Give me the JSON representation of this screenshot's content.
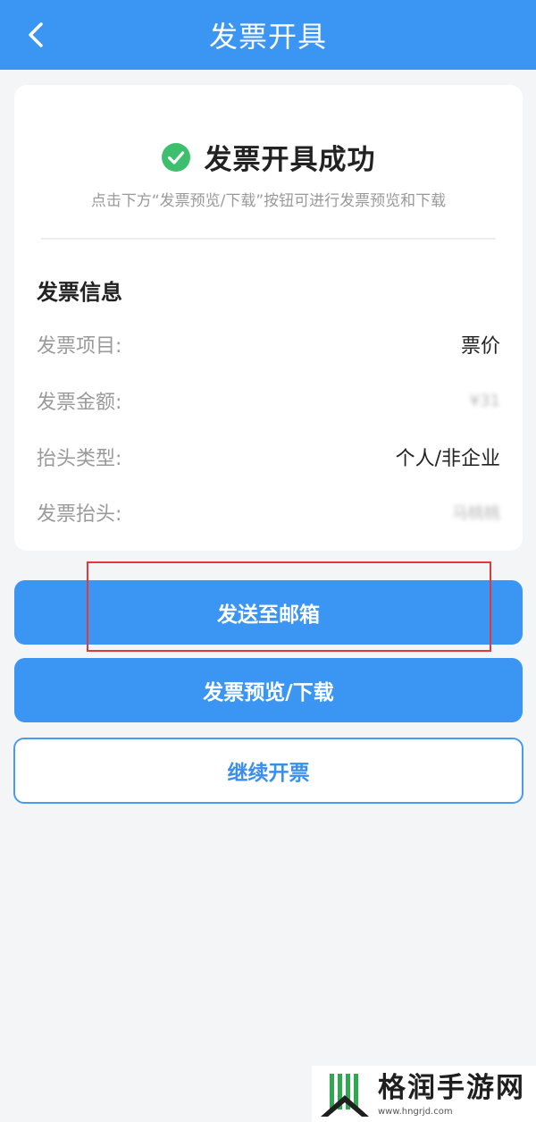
{
  "header": {
    "title": "发票开具",
    "back_icon": "chevron-left-icon"
  },
  "result": {
    "icon": "check-circle-icon",
    "icon_color": "#3dbf6d",
    "title": "发票开具成功",
    "hint": "点击下方“发票预览/下载”按钮可进行发票预览和下载"
  },
  "invoice_info": {
    "section_title": "发票信息",
    "rows": [
      {
        "label": "发票项目:",
        "value": "票价",
        "blurred": false
      },
      {
        "label": "发票金额:",
        "value": "¥31",
        "blurred": true
      },
      {
        "label": "抬头类型:",
        "value": "个人/非企业",
        "blurred": false
      },
      {
        "label": "发票抬头:",
        "value": "马桃桃",
        "blurred": true
      }
    ]
  },
  "actions": {
    "send_email": "发送至邮箱",
    "preview_download": "发票预览/下载",
    "continue": "继续开票"
  },
  "watermark": {
    "name": "格润手游网",
    "url": "www.hngrjd.com"
  },
  "colors": {
    "primary": "#3b95f3",
    "success": "#3dbf6d",
    "highlight": "#e23a3a"
  }
}
